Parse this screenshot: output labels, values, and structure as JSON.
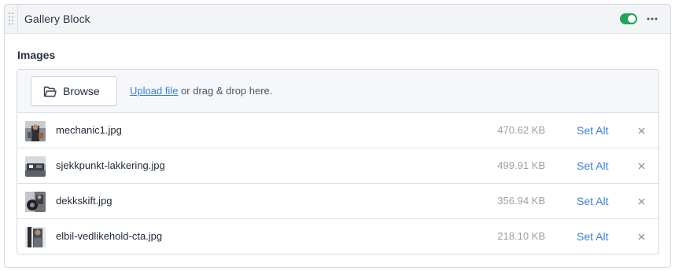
{
  "block": {
    "title": "Gallery Block",
    "enabled": true,
    "colors": {
      "toggle_on": "#22a35a",
      "link": "#3b82d6"
    }
  },
  "images_field": {
    "label": "Images",
    "browse_label": "Browse",
    "upload_link": "Upload file",
    "drop_hint": " or drag & drop here.",
    "set_alt_label": "Set Alt",
    "files": [
      {
        "name": "mechanic1.jpg",
        "size": "470.62 KB"
      },
      {
        "name": "sjekkpunkt-lakkering.jpg",
        "size": "499.91 KB"
      },
      {
        "name": "dekkskift.jpg",
        "size": "356.94 KB"
      },
      {
        "name": "elbil-vedlikehold-cta.jpg",
        "size": "218.10 KB"
      }
    ]
  },
  "icons": {
    "drag": "drag-handle-icon",
    "more": "more-horizontal-icon",
    "folder": "folder-open-icon",
    "remove": "close-icon"
  }
}
